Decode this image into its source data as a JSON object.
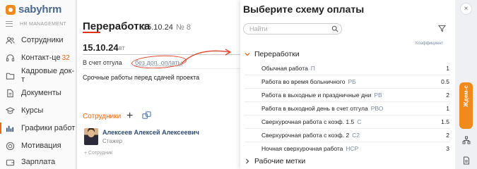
{
  "sidebar": {
    "logo": "sabyhrm",
    "section": "HR MANAGEMENT",
    "items": [
      {
        "label": "Сотрудники",
        "icon": "people-icon"
      },
      {
        "label": "Контакт-це",
        "badge": "32",
        "icon": "headset-icon"
      },
      {
        "label": "Кадровые док-т",
        "icon": "folder-icon"
      },
      {
        "label": "Документы",
        "icon": "document-icon"
      },
      {
        "label": "Курсы",
        "icon": "graduation-cap-icon"
      },
      {
        "label": "Графики работ",
        "icon": "bar-chart-icon"
      },
      {
        "label": "Мотивация",
        "icon": "target-icon"
      },
      {
        "label": "Зарплата",
        "icon": "wallet-icon"
      }
    ]
  },
  "card": {
    "title": "Переработка",
    "date": "15.10.24",
    "number": "№ 8",
    "big_date": "15.10.24",
    "weekday": "вт",
    "otgul_label": "В счет отгула",
    "otgul_link": "без доп. оплаты",
    "description": "Срочные работы перед сдачей проекта",
    "staff_title": "Сотрудники",
    "plus": "+",
    "employee": {
      "name": "Алексеев Алексей Алексеевич",
      "role": "Стажер"
    },
    "add_staff": "+ Сотрудник"
  },
  "panel": {
    "title": "Выберите схему оплаты",
    "search_placeholder": "Найти",
    "coef_header": "Коэффициент",
    "groups": [
      {
        "label": "Переработки",
        "expanded": true
      },
      {
        "label": "Рабочие метки",
        "expanded": false
      }
    ],
    "rows": [
      {
        "name": "Обычная работа",
        "code": "П",
        "coef": "1"
      },
      {
        "name": "Работа во время больничного",
        "code": "РБ",
        "coef": "0.5"
      },
      {
        "name": "Работа в выходные и праздничные дни",
        "code": "РВ",
        "coef": "2"
      },
      {
        "name": "Работа в выходной день в счет отгула",
        "code": "РВО",
        "coef": "1"
      },
      {
        "name": "Сверхурочная работа с коэф. 1.5",
        "code": "С",
        "coef": "1.5"
      },
      {
        "name": "Сверхурочная работа с коэф. 2",
        "code": "С2",
        "coef": "2"
      },
      {
        "name": "Ночная сверхурочная работа",
        "code": "НСР",
        "coef": "3"
      }
    ]
  },
  "rail": {
    "close": "×",
    "wait_label": "Ждем-с"
  },
  "colors": {
    "accent": "#e46b1a",
    "red": "#e0321c",
    "link": "#7a8aa0",
    "name": "#2c4a74"
  }
}
